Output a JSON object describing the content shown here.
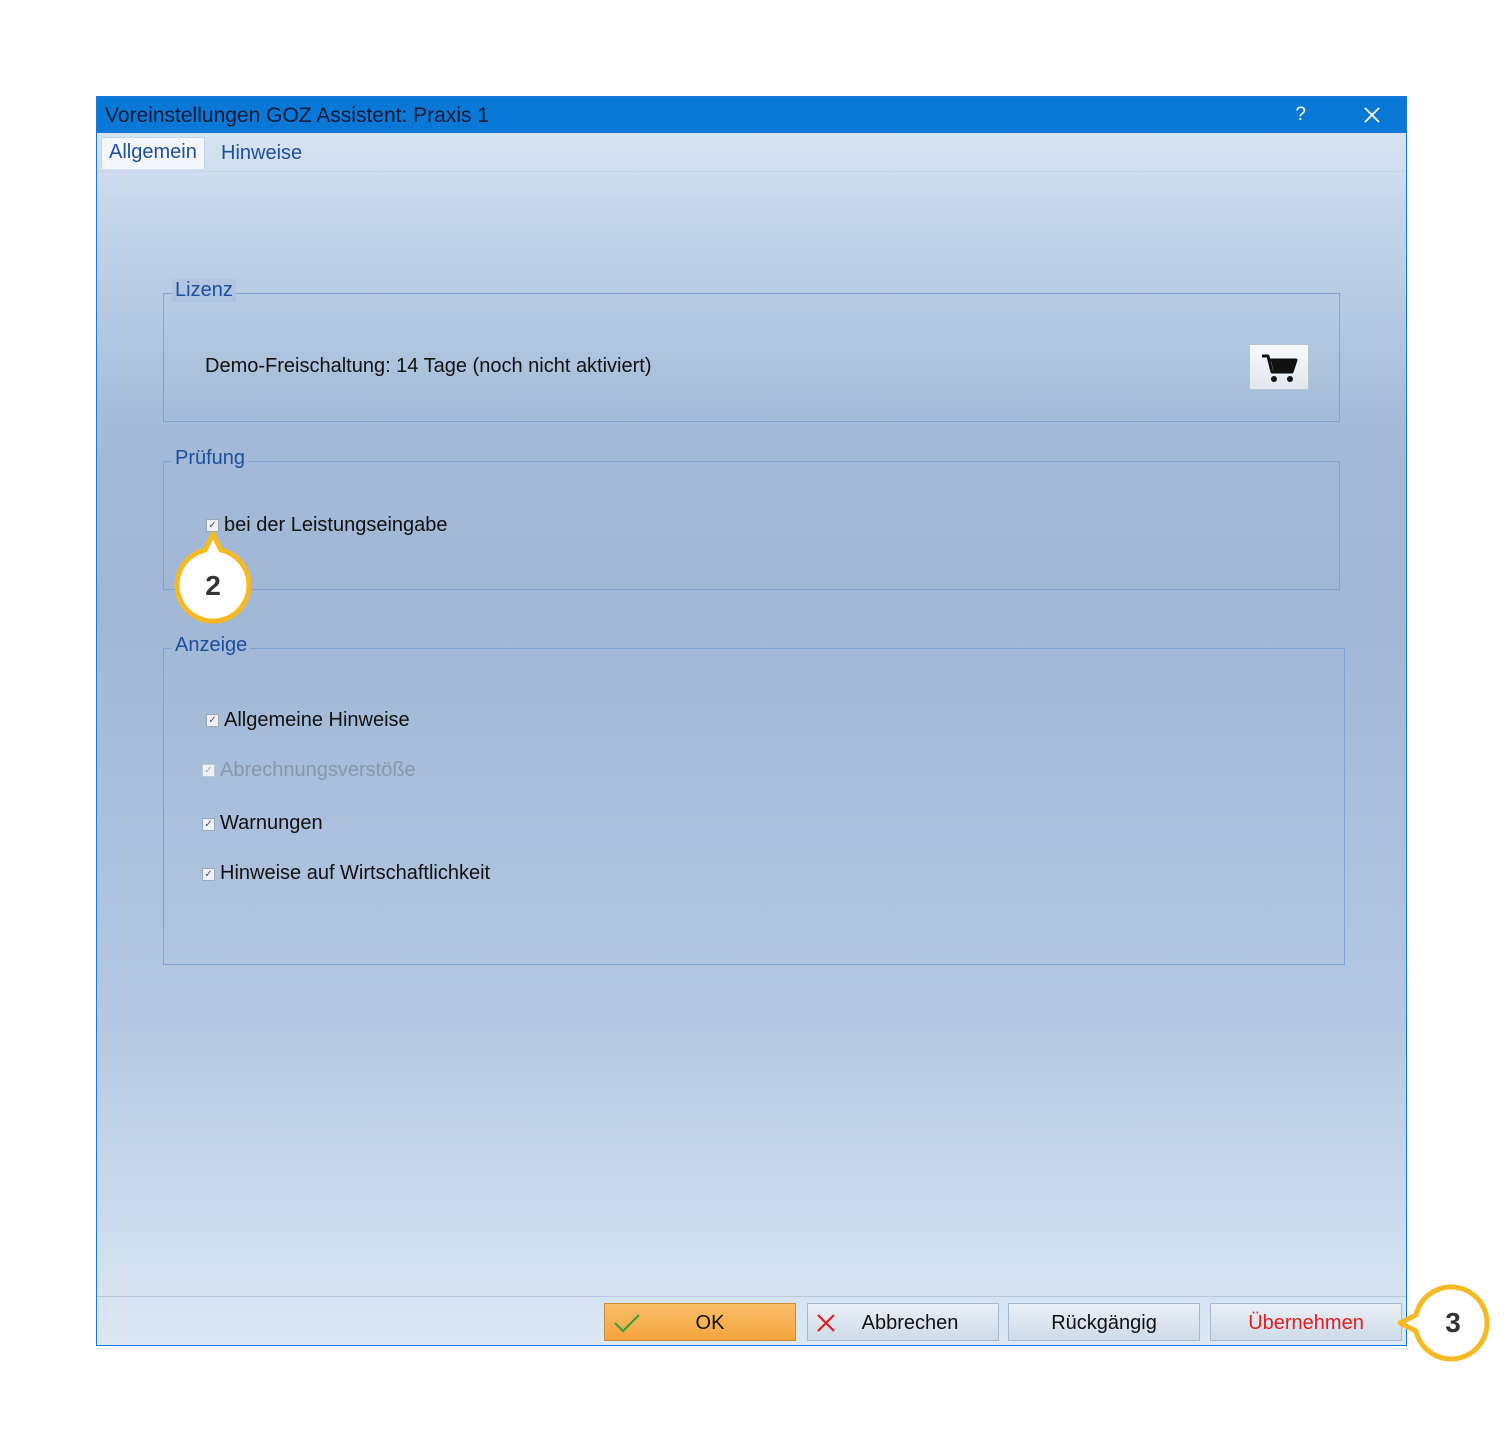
{
  "dialog": {
    "title": "Voreinstellungen GOZ Assistent: Praxis 1",
    "help": "?",
    "tabs": [
      {
        "label": "Allgemein",
        "active": true
      },
      {
        "label": "Hinweise",
        "active": false
      }
    ]
  },
  "lizenz": {
    "legend": "Lizenz",
    "text": "Demo-Freischaltung: 14 Tage (noch nicht aktiviert)",
    "cart_icon": "shopping-cart-icon"
  },
  "pruefung": {
    "legend": "Prüfung",
    "items": [
      {
        "label": "bei der Leistungseingabe",
        "checked": true,
        "enabled": true
      }
    ]
  },
  "anzeige": {
    "legend": "Anzeige",
    "items": [
      {
        "label": "Allgemeine Hinweise",
        "checked": true,
        "enabled": true
      },
      {
        "label": "Abrechnungsverstöße",
        "checked": true,
        "enabled": false
      },
      {
        "label": "Warnungen",
        "checked": true,
        "enabled": true
      },
      {
        "label": "Hinweise auf Wirtschaftlichkeit",
        "checked": true,
        "enabled": true
      }
    ]
  },
  "buttons": {
    "ok": "OK",
    "cancel": "Abbrechen",
    "undo": "Rückgängig",
    "apply": "Übernehmen"
  },
  "callouts": {
    "two": "2",
    "three": "3"
  },
  "colors": {
    "titlebar": "#0a78d7",
    "accent_callout": "#f5b921",
    "ok_button": "#f4a43d",
    "apply_text": "#e01e1e"
  }
}
